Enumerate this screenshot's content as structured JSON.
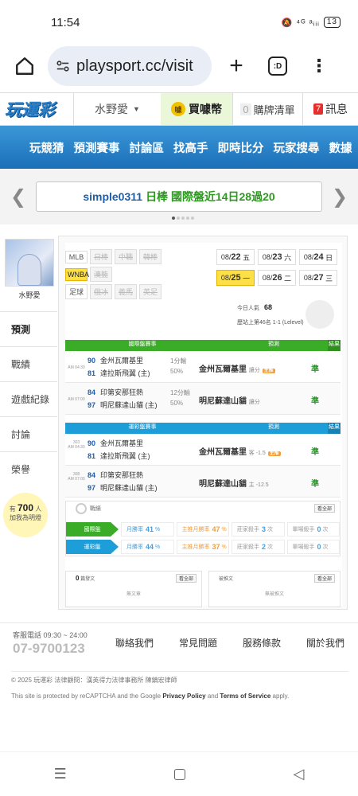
{
  "status": {
    "time": "11:54",
    "icons": "🔕 ⁴ᴳ ᵃᵢᵢᵢ",
    "battery": "13"
  },
  "browser": {
    "url": "playsport.cc/visit",
    "tab_icon": ":D"
  },
  "site": {
    "logo": "玩運彩",
    "user": "水野愛",
    "coin_label": "買噱幣",
    "coin_icon": "噱",
    "cart_count": "0",
    "cart_label": "購牌清單",
    "msg_count": "7",
    "msg_label": "訊息"
  },
  "nav": [
    "玩競猜",
    "預測賽事",
    "討論區",
    "找高手",
    "即時比分",
    "玩家搜尋",
    "數據"
  ],
  "ticker": {
    "user": "simple0311",
    "text": "日棒 國際盤近14日28過20"
  },
  "profile": {
    "name": "水野愛"
  },
  "sidebar": [
    "預測",
    "戰績",
    "遊戲紀錄",
    "討論",
    "榮譽"
  ],
  "bulb": {
    "pre": "有",
    "count": "700",
    "unit": "人",
    "post": "加我為明燈"
  },
  "sports": [
    {
      "label": "MLB",
      "others": [
        "日棒",
        "中職",
        "韓棒"
      ],
      "selected": false
    },
    {
      "label": "WNBA",
      "others": [
        "澳籃"
      ],
      "selected": true
    },
    {
      "label": "足球",
      "others": [
        "俄冰",
        "義馬",
        "英足"
      ],
      "selected": false
    }
  ],
  "dates": [
    {
      "d": "08/",
      "n": "22",
      "w": "五"
    },
    {
      "d": "08/",
      "n": "23",
      "w": "六"
    },
    {
      "d": "08/",
      "n": "24",
      "w": "日"
    },
    {
      "d": "08/",
      "n": "25",
      "w": "一",
      "sel": true
    },
    {
      "d": "08/",
      "n": "26",
      "w": "二"
    },
    {
      "d": "08/",
      "n": "27",
      "w": "三"
    }
  ],
  "popularity": {
    "label": "今日人氣",
    "value": "68",
    "rank": "歷站上第46名 1-1 (Lelevel)"
  },
  "intl": {
    "header": {
      "a": "國際盤賽事",
      "b": "預測",
      "c": "結果"
    },
    "rows": [
      {
        "time": "AM 04:30",
        "s1": "90",
        "t1": "金州瓦爾基里",
        "s2": "81",
        "t2": "達拉斯飛翼 (主)",
        "line1": "1分輸",
        "line2": "50%",
        "pick": "金州瓦爾基里",
        "ptype": "讓分",
        "mark": "主推",
        "res": "準"
      },
      {
        "time": "AM 07:00",
        "s1": "84",
        "t1": "印第安那狂熱",
        "s2": "97",
        "t2": "明尼蘇達山貓 (主)",
        "line1": "12分輸",
        "line2": "50%",
        "pick": "明尼蘇達山貓",
        "ptype": "讓分",
        "mark": "",
        "res": "準"
      }
    ]
  },
  "lottery": {
    "header": {
      "a": "運彩盤賽事",
      "b": "預測",
      "c": "結果"
    },
    "rows": [
      {
        "time": "AM 04:30",
        "code": "303",
        "s1": "90",
        "t1": "金州瓦爾基里",
        "s2": "81",
        "t2": "達拉斯飛翼 (主)",
        "pick": "金州瓦爾基里",
        "ptype": "客 -1.5",
        "mark": "主推",
        "res": "準"
      },
      {
        "time": "AM 07:00",
        "code": "308",
        "s1": "84",
        "t1": "印第安那狂熱",
        "s2": "97",
        "t2": "明尼蘇達山貓 (主)",
        "pick": "明尼蘇達山貓",
        "ptype": "主 -12.5",
        "mark": "",
        "res": "準"
      }
    ]
  },
  "record": {
    "title": "戰績",
    "see_all": "看全部",
    "rows": [
      {
        "tag": "國際盤",
        "color": "#3aac27",
        "win": "月勝率",
        "winv": "41",
        "mwin": "主推月勝率",
        "mwinv": "47",
        "streak": "莊家殺手",
        "streakv": "3",
        "single": "單場殺手",
        "singlev": "0"
      },
      {
        "tag": "運彩盤",
        "color": "#1e9ed9",
        "win": "月勝率",
        "winv": "44",
        "mwin": "主推月勝率",
        "mwinv": "37",
        "streak": "莊家殺手",
        "streakv": "2",
        "single": "單場殺手",
        "singlev": "0"
      }
    ]
  },
  "posts": {
    "left_count": "0",
    "left_label": "篇發文",
    "left_empty": "無文章",
    "right_label": "被推文",
    "right_empty": "無被推文",
    "see_all": "看全部"
  },
  "footer": {
    "hotline": "客服電話 09:30 ~ 24:00",
    "phone": "07-9700123",
    "links": [
      "聯絡我們",
      "常見問題",
      "服務條款",
      "關於我們"
    ],
    "copyright": "© 2025 玩運彩 法律顧問：漢英得力法律事務所 陳鎮宏律師",
    "recaptcha": "This site is protected by reCAPTCHA and the Google",
    "privacy": "Privacy Policy",
    "and": "and",
    "terms": "Terms of Service",
    "apply": "apply."
  }
}
